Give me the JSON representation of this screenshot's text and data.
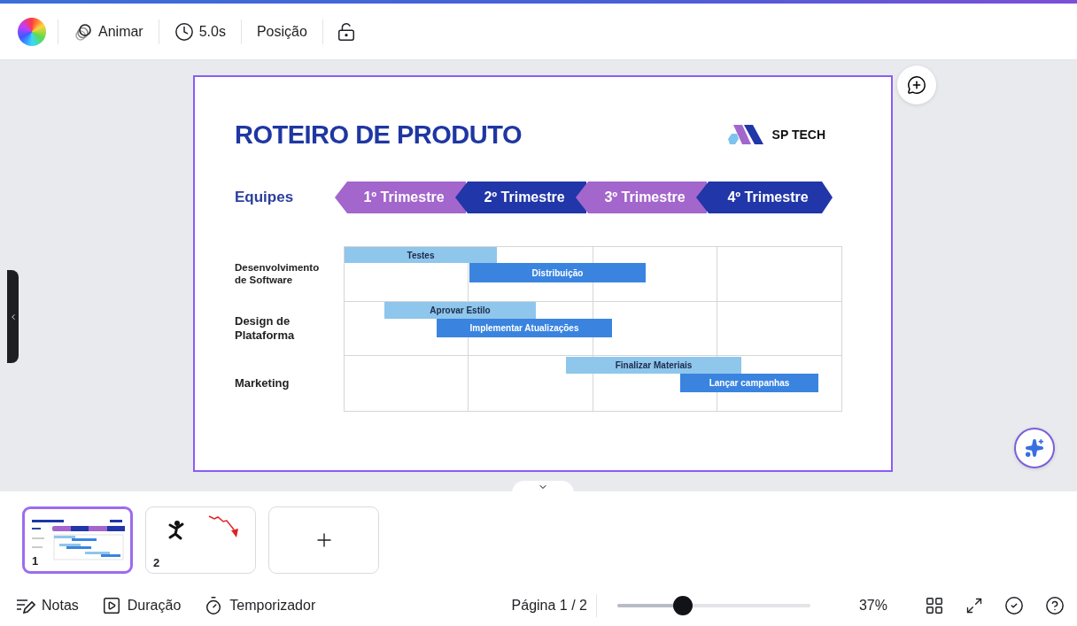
{
  "toolbar": {
    "animate": "Animar",
    "duration": "5.0s",
    "position": "Posição"
  },
  "slide": {
    "title": "ROTEIRO DE PRODUTO",
    "logo_text": "SP TECH",
    "teams_label": "Equipes",
    "quarters": [
      {
        "label": "1º Trimestre",
        "color": "#a366cc"
      },
      {
        "label": "2º Trimestre",
        "color": "#2136a8"
      },
      {
        "label": "3º Trimestre",
        "color": "#a366cc"
      },
      {
        "label": "4º Trimestre",
        "color": "#2136a8"
      }
    ],
    "rows": [
      {
        "team": "Desenvolvimento de Software",
        "tasks": [
          {
            "label": "Testes",
            "kind": "light"
          },
          {
            "label": "Distribuição",
            "kind": "dark"
          }
        ]
      },
      {
        "team": "Design de Plataforma",
        "tasks": [
          {
            "label": "Aprovar Estilo",
            "kind": "light"
          },
          {
            "label": "Implementar Atualizações",
            "kind": "dark"
          }
        ]
      },
      {
        "team": "Marketing",
        "tasks": [
          {
            "label": "Finalizar Materiais",
            "kind": "light"
          },
          {
            "label": "Lançar campanhas",
            "kind": "dark"
          }
        ]
      }
    ]
  },
  "pages": [
    {
      "number": "1",
      "selected": true,
      "kind": "roadmap"
    },
    {
      "number": "2",
      "selected": false,
      "kind": "figure"
    }
  ],
  "footer": {
    "notes": "Notas",
    "duration": "Duração",
    "timer": "Temporizador",
    "page": "Página 1 / 2",
    "zoom": {
      "level": 0.34
    },
    "zoom_reading": "37%"
  }
}
